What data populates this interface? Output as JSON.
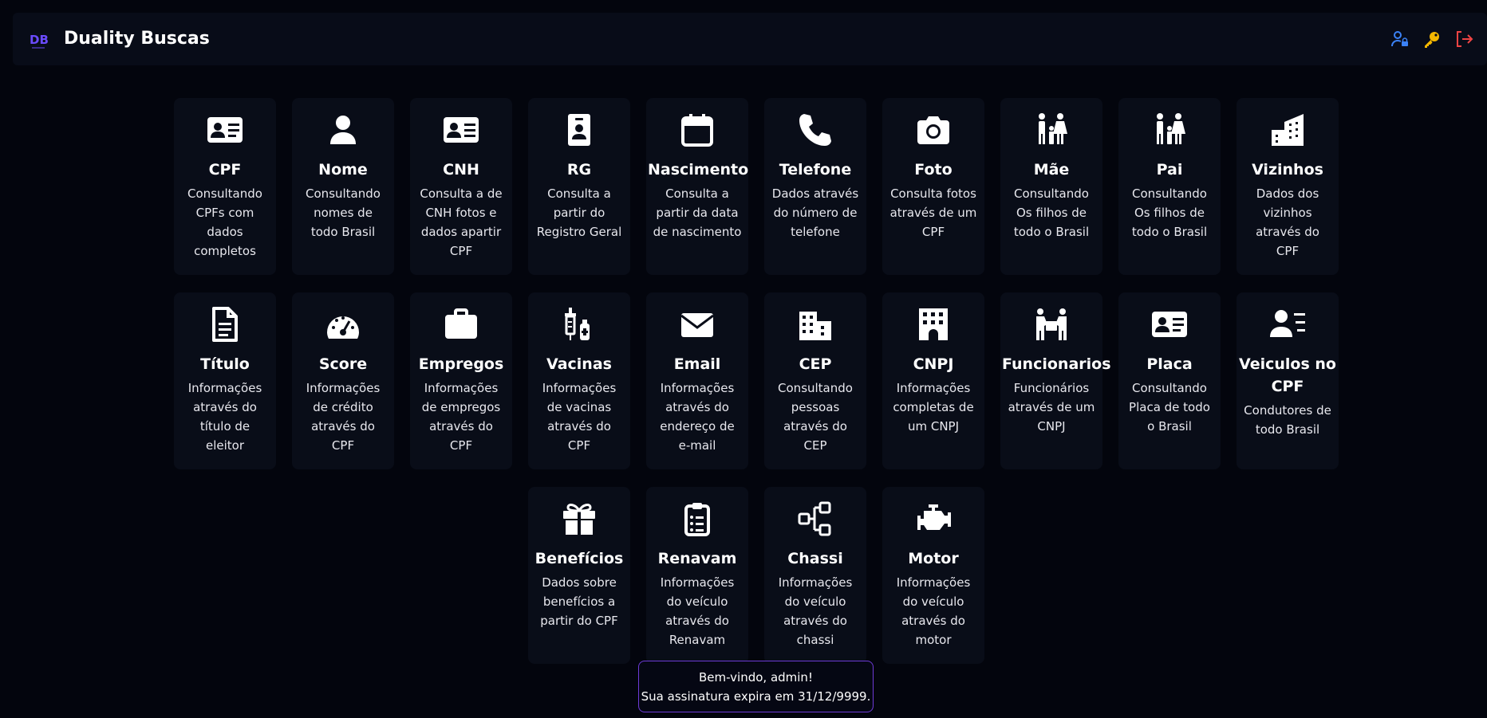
{
  "header": {
    "logo_text": "DB",
    "title": "Duality Buscas",
    "icons": [
      {
        "name": "user-lock-icon",
        "color": "#3b82f6"
      },
      {
        "name": "key-icon",
        "color": "#f5b800"
      },
      {
        "name": "logout-icon",
        "color": "#ef4444"
      }
    ]
  },
  "cards": [
    {
      "title": "CPF",
      "desc": "Consultando CPFs com dados completos",
      "icon": "id-card-icon"
    },
    {
      "title": "Nome",
      "desc": "Consultando nomes de todo Brasil",
      "icon": "user-icon"
    },
    {
      "title": "CNH",
      "desc": "Consulta a de CNH fotos e dados apartir CPF",
      "icon": "license-icon"
    },
    {
      "title": "RG",
      "desc": "Consulta a partir do Registro Geral",
      "icon": "badge-icon"
    },
    {
      "title": "Nascimento",
      "desc": "Consulta a partir da data de nascimento",
      "icon": "calendar-icon"
    },
    {
      "title": "Telefone",
      "desc": "Dados através do número de telefone",
      "icon": "phone-icon"
    },
    {
      "title": "Foto",
      "desc": "Consulta fotos através de um CPF",
      "icon": "camera-icon"
    },
    {
      "title": "Mãe",
      "desc": "Consultando Os filhos de todo o Brasil",
      "icon": "family-icon"
    },
    {
      "title": "Pai",
      "desc": "Consultando Os filhos de todo o Brasil",
      "icon": "family-icon"
    },
    {
      "title": "Vizinhos",
      "desc": "Dados dos vizinhos através do CPF",
      "icon": "city-icon"
    },
    {
      "title": "Título",
      "desc": "Informações através do título de eleitor",
      "icon": "document-icon"
    },
    {
      "title": "Score",
      "desc": "Informações de crédito através do CPF",
      "icon": "gauge-icon"
    },
    {
      "title": "Empregos",
      "desc": "Informações de empregos através do CPF",
      "icon": "briefcase-icon"
    },
    {
      "title": "Vacinas",
      "desc": "Informações de vacinas através do CPF",
      "icon": "syringe-icon"
    },
    {
      "title": "Email",
      "desc": "Informações através do endereço de e-mail",
      "icon": "envelope-icon"
    },
    {
      "title": "CEP",
      "desc": "Consultando pessoas através do CEP",
      "icon": "building-icon"
    },
    {
      "title": "CNPJ",
      "desc": "Informações completas de um CNPJ",
      "icon": "office-icon"
    },
    {
      "title": "Funcionarios",
      "desc": "Funcionários através de um CNPJ",
      "icon": "workers-icon"
    },
    {
      "title": "Placa",
      "desc": "Consultando Placa de todo o Brasil",
      "icon": "id-card-icon"
    },
    {
      "title": "Veiculos no CPF",
      "desc": "Condutores de todo Brasil",
      "icon": "user-list-icon"
    },
    {
      "title": "Benefícios",
      "desc": "Dados sobre benefícios a partir do CPF",
      "icon": "gift-icon"
    },
    {
      "title": "Renavam",
      "desc": "Informações do veículo através do Renavam",
      "icon": "clipboard-icon"
    },
    {
      "title": "Chassi",
      "desc": "Informações do veículo através do chassi",
      "icon": "diagram-icon"
    },
    {
      "title": "Motor",
      "desc": "Informações do veículo através do motor",
      "icon": "engine-icon"
    }
  ],
  "toast": {
    "line1": "Bem-vindo, admin!",
    "line2": "Sua assinatura expira em 31/12/9999."
  }
}
